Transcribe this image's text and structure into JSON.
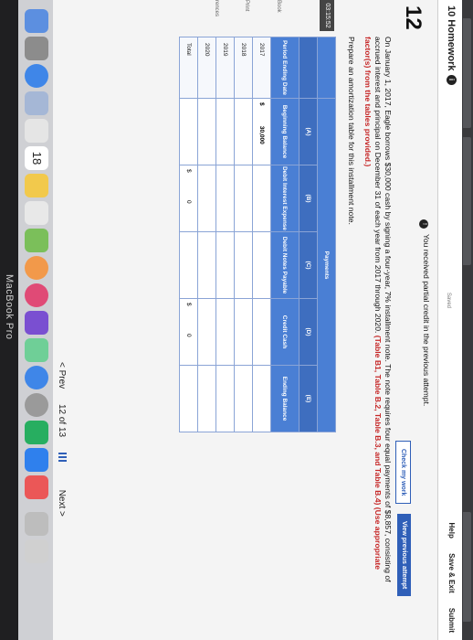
{
  "header": {
    "title": "10 Homework",
    "info_icon": "i",
    "saved_label": "Saved",
    "help": "Help",
    "save_exit": "Save & Exit",
    "submit": "Submit"
  },
  "question": {
    "number": "12",
    "partial_credit": "You received partial credit in the previous attempt.",
    "check_my_work": "Check my work",
    "view_previous_attempt": "View previous attempt",
    "problem_text": "On January 1, 2017, Eagle borrows $30,000 cash by signing a four-year, 7% installment note. The note requires four equal payments of $8,857, consisting of accrued interest and principal on December 31 of each year from 2017 through 2020.",
    "problem_emphasis": "(Table B1, Table B.2, Table B.3, and Table B.4) (Use appropriate factor(s) from the tables provided.)",
    "instruction": "Prepare an amortization table for this installment note."
  },
  "sidebar": {
    "timer": "03:15:52",
    "book": "Book",
    "print": "Print",
    "references": "rences"
  },
  "table": {
    "payments_label": "Payments",
    "letters": [
      "",
      "(A)",
      "(B)",
      "(C)",
      "(D)",
      "(E)"
    ],
    "headers": [
      "Period Ending Date",
      "Beginning Balance",
      "Debit Interest Expense",
      "Debit Notes Payable",
      "Credit Cash",
      "Ending Balance"
    ],
    "rows": [
      {
        "year": "2017",
        "cur": "$",
        "value": "30,000"
      },
      {
        "year": "2018",
        "cur": "",
        "value": ""
      },
      {
        "year": "2019",
        "cur": "",
        "value": ""
      },
      {
        "year": "2020",
        "cur": "",
        "value": ""
      }
    ],
    "total_label": "Total",
    "totals": {
      "interest_cur": "$",
      "interest": "0",
      "cash_cur": "$",
      "cash": "0"
    }
  },
  "pager": {
    "prev": "< Prev",
    "position": "12 of 13",
    "next": "Next >"
  },
  "dock": {
    "calendar_day": "18"
  },
  "footer": {
    "device": "MacBook Pro"
  }
}
